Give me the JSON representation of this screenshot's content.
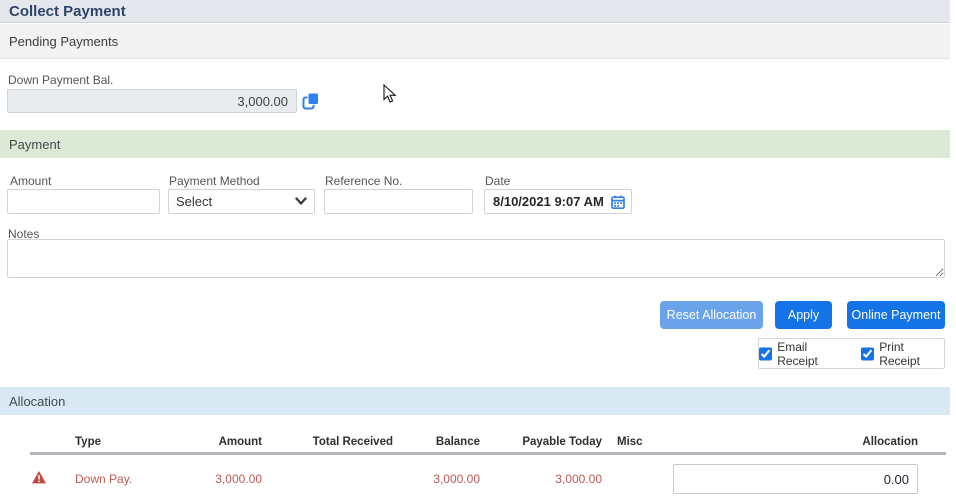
{
  "window": {
    "title": "Collect Payment"
  },
  "pending_payments": {
    "header": "Pending Payments",
    "down_payment_label": "Down Payment Bal.",
    "down_payment_value": "3,000.00"
  },
  "payment": {
    "header": "Payment",
    "amount_label": "Amount",
    "amount_value": "",
    "method_label": "Payment Method",
    "method_value": "Select",
    "reference_label": "Reference No.",
    "reference_value": "",
    "date_label": "Date",
    "date_value": "8/10/2021 9:07 AM",
    "notes_label": "Notes",
    "notes_value": "",
    "reset_button": "Reset Allocation",
    "apply_button": "Apply",
    "online_button": "Online Payment",
    "email_receipt_label": "Email Receipt",
    "email_receipt_checked": "checked",
    "print_receipt_label": "Print Receipt",
    "print_receipt_checked": "checked"
  },
  "allocation": {
    "header": "Allocation",
    "columns": [
      "Type",
      "Amount",
      "Total Received",
      "Balance",
      "Payable Today",
      "Misc",
      "Allocation"
    ],
    "rows": [
      {
        "type": "Down Pay.",
        "amount": "3,000.00",
        "total_received": "",
        "balance": "3,000.00",
        "payable_today": "3,000.00",
        "misc": "",
        "allocation_input": "0.00"
      }
    ]
  },
  "icons": {
    "copy": "copy-icon (blue duplicate sheets)",
    "calendar": "calendar-icon (blue)",
    "chevron": "chevron-down-icon",
    "warning": "warning-icon (red triangle with exclamation)"
  },
  "colors": {
    "title_text": "#2e4468",
    "title_bar_bg": "#e4e8ec",
    "pending_bar_bg": "#f2f2f3",
    "payment_bar_bg": "#dcead5",
    "allocation_bar_bg": "#d8e9f3",
    "primary_blue": "#1473e6",
    "muted_blue": "#6aa3e9",
    "alert_red": "#c05a52",
    "disabled_input_bg": "#e9ecef"
  }
}
